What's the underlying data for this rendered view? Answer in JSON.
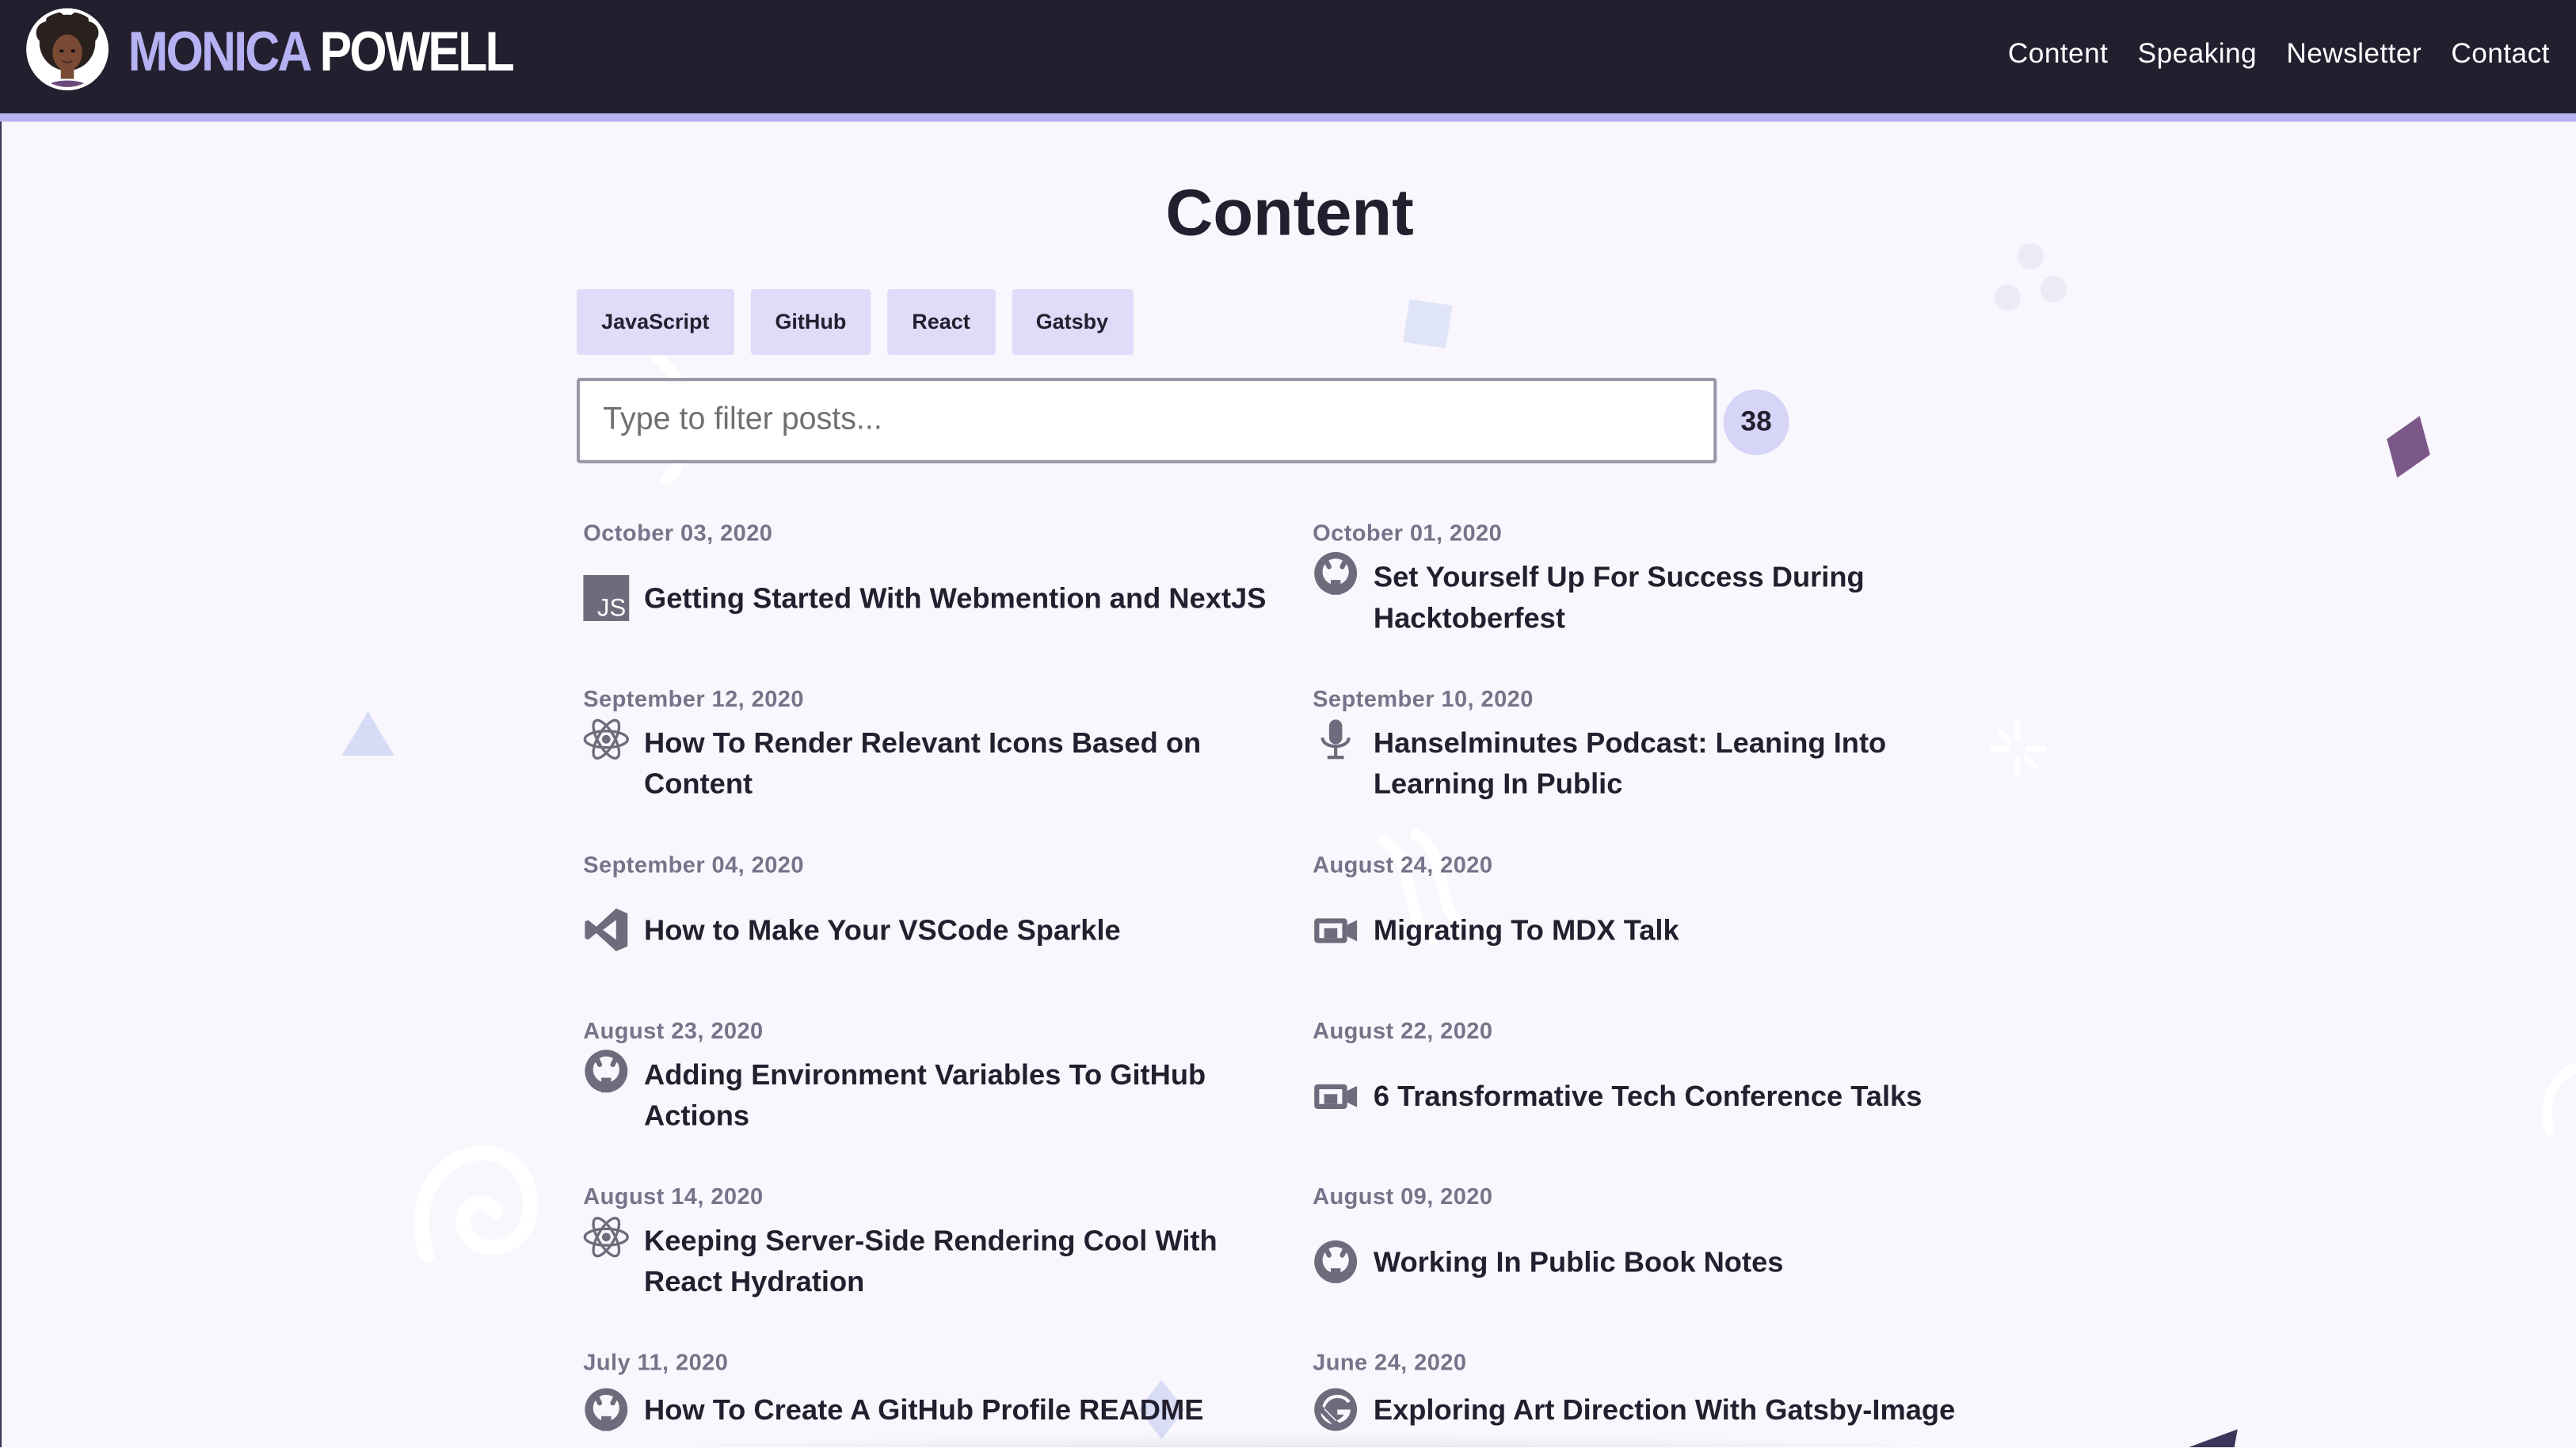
{
  "header": {
    "brand_first": "MONICA",
    "brand_last": "POWELL",
    "nav": [
      "Content",
      "Speaking",
      "Newsletter",
      "Contact"
    ]
  },
  "page_title": "Content",
  "tags": [
    "JavaScript",
    "GitHub",
    "React",
    "Gatsby"
  ],
  "filter": {
    "placeholder": "Type to filter posts...",
    "value": "",
    "count": "38"
  },
  "posts": [
    {
      "date": "October 03, 2020",
      "title": "Getting Started With Webmention and NextJS",
      "icon": "javascript-icon"
    },
    {
      "date": "October 01, 2020",
      "title": "Set Yourself Up For Success During Hacktoberfest",
      "icon": "github-icon"
    },
    {
      "date": "September 12, 2020",
      "title": "How To Render Relevant Icons Based on Content",
      "icon": "react-icon"
    },
    {
      "date": "September 10, 2020",
      "title": "Hanselminutes Podcast: Leaning Into Learning In Public",
      "icon": "microphone-icon"
    },
    {
      "date": "September 04, 2020",
      "title": "How to Make Your VSCode Sparkle",
      "icon": "vscode-icon"
    },
    {
      "date": "August 24, 2020",
      "title": "Migrating To MDX Talk",
      "icon": "video-camera-icon"
    },
    {
      "date": "August 23, 2020",
      "title": "Adding Environment Variables To GitHub Actions",
      "icon": "github-icon"
    },
    {
      "date": "August 22, 2020",
      "title": "6 Transformative Tech Conference Talks",
      "icon": "video-camera-icon"
    },
    {
      "date": "August 14, 2020",
      "title": "Keeping Server-Side Rendering Cool With React Hydration",
      "icon": "react-icon"
    },
    {
      "date": "August 09, 2020",
      "title": "Working In Public Book Notes",
      "icon": "github-icon"
    },
    {
      "date": "July 11, 2020",
      "title": "How To Create A GitHub Profile README",
      "icon": "github-icon"
    },
    {
      "date": "June 24, 2020",
      "title": "Exploring Art Direction With Gatsby-Image",
      "icon": "gatsby-icon"
    }
  ],
  "colors": {
    "header_bg": "#231f2f",
    "accent_lavender": "#b6b1f2",
    "tag_bg": "#dedcf8",
    "page_bg": "#f9f7fd",
    "icon_gray": "#6f6b7d"
  }
}
